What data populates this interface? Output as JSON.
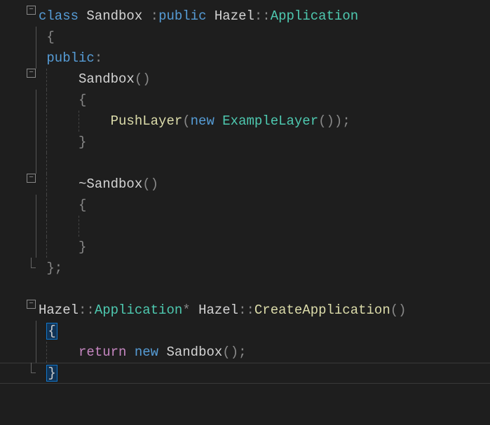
{
  "code": {
    "l1": {
      "kw1": "class",
      "name": "Sandbox",
      "colon": ":",
      "kw2": "public",
      "ns": "Hazel",
      "sep": "::",
      "base": "Application"
    },
    "l2": {
      "brace": "{"
    },
    "l3": {
      "access": "public",
      "colon": ":"
    },
    "l4": {
      "ctor": "Sandbox",
      "paren": "()"
    },
    "l5": {
      "brace": "{"
    },
    "l6": {
      "call": "PushLayer",
      "open": "(",
      "kw": "new",
      "type": "ExampleLayer",
      "paren2": "()",
      "close": ")",
      "semi": ";"
    },
    "l7": {
      "brace": "}"
    },
    "l9": {
      "dtor": "~Sandbox",
      "paren": "()"
    },
    "l10": {
      "brace": "{"
    },
    "l12": {
      "brace": "}"
    },
    "l13": {
      "brace": "};"
    },
    "l15": {
      "ns1": "Hazel",
      "sep1": "::",
      "type1": "Application",
      "ptr": "*",
      "ns2": "Hazel",
      "sep2": "::",
      "func": "CreateApplication",
      "paren": "()"
    },
    "l16": {
      "brace": "{"
    },
    "l17": {
      "ret": "return",
      "kw": "new",
      "type": "Sandbox",
      "paren": "()",
      "semi": ";"
    },
    "l18": {
      "brace": "}"
    }
  }
}
